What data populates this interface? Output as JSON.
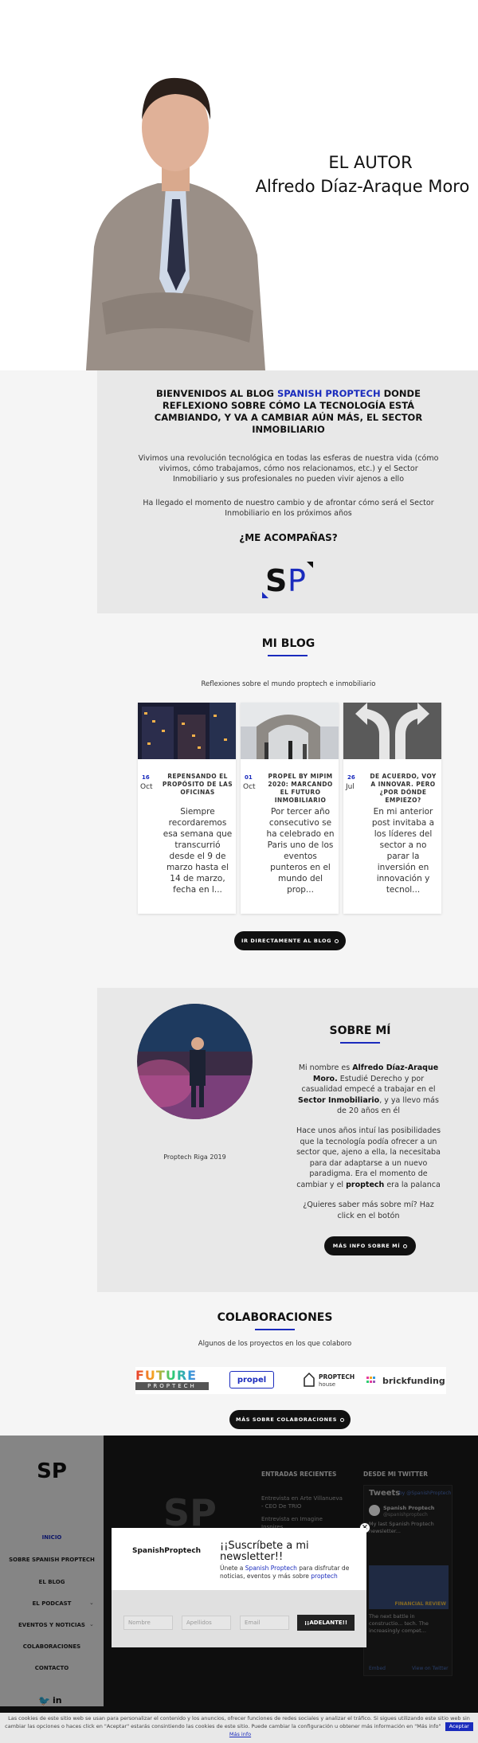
{
  "hero": {
    "line1": "EL AUTOR",
    "line2": "Alfredo Díaz-Araque Moro"
  },
  "welcome": {
    "heading_pre": "BIENVENIDOS AL BLOG",
    "heading_brand": "SPANISH PROPTECH",
    "heading_post": "DONDE REFLEXIONO SOBRE CÓMO LA TECNOLOGÍA ESTÁ CAMBIANDO, Y VA A CAMBIAR AÚN MÁS, EL SECTOR INMOBILIARIO",
    "para1": "Vivimos una revolución tecnológica en todas las esferas de nuestra vida (cómo vivimos, cómo trabajamos, cómo nos relacionamos, etc.) y el Sector Inmobiliario y sus profesionales no pueden vivir ajenos a ello",
    "para2": "Ha llegado el momento de nuestro cambio y de afrontar cómo será el Sector Inmobiliario en los próximos años",
    "question": "¿ME ACOMPAÑAS?",
    "logo_s": "S",
    "logo_p": "P"
  },
  "blog": {
    "title": "MI BLOG",
    "subtitle": "Reflexiones sobre el mundo proptech e inmobiliario",
    "posts": [
      {
        "day": "16",
        "month": "Oct",
        "title": "REPENSANDO EL PROPÓSITO DE LAS OFICINAS",
        "excerpt": "Siempre recordaremos esa semana que transcurrió desde el 9 de marzo hasta el 14 de marzo, fecha en l..."
      },
      {
        "day": "01",
        "month": "Oct",
        "title": "PROPEL BY MIPIM 2020: MARCANDO EL FUTURO INMOBILIARIO",
        "excerpt": "Por tercer año consecutivo se ha celebrado en Paris uno de los eventos punteros en el mundo del prop..."
      },
      {
        "day": "26",
        "month": "Jul",
        "title": "DE ACUERDO, VOY A INNOVAR. PERO ¿POR DÓNDE EMPIEZO?",
        "excerpt": "En mi anterior post invitaba a los líderes del sector a no parar la inversión en innovación y tecnol..."
      }
    ],
    "button": "IR DIRECTAMENTE AL BLOG"
  },
  "about": {
    "title": "SOBRE MÍ",
    "photo_caption": "Proptech Riga 2019",
    "p1_a": "Mi nombre es",
    "p1_name": "Alfredo Díaz-Araque Moro.",
    "p1_b": "Estudié Derecho y por casualidad empecé a trabajar en el",
    "p1_sector": "Sector Inmobiliario",
    "p1_c": ", y ya llevo más de 20 años en él",
    "p2_a": "Hace unos años intuí las posibilidades que la tecnología podía ofrecer a un sector que, ajeno a ella, la necesitaba para dar adaptarse a un nuevo paradigma. Era el momento de cambiar y el",
    "p2_bold": "proptech",
    "p2_b": "era la palanca",
    "p3": "¿Quieres saber más sobre mí? Haz click en el botón",
    "button": "MÁS INFO SOBRE MÍ"
  },
  "collab": {
    "title": "COLABORACIONES",
    "subtitle": "Algunos de los proyectos en los que colaboro",
    "logos": {
      "future_top": "FUTURE",
      "future_bottom": "PROPTECH",
      "propel": "propel",
      "proptech_house_a": "PROPTECH",
      "proptech_house_b": "house",
      "brickfunding": "brickfunding"
    },
    "button": "MÁS SOBRE COLABORACIONES"
  },
  "sidebar": {
    "logo": "SP",
    "menu": [
      "INICIO",
      "SOBRE SPANISH PROPTECH",
      "EL BLOG",
      "EL PODCAST",
      "EVENTOS Y NOTICIAS",
      "COLABORACIONES",
      "CONTACTO"
    ]
  },
  "footer": {
    "recent_title": "ENTRADAS RECIENTES",
    "recent": [
      "Entrevista en Arte Villanueva - CEO De TRIO",
      "Entrevista en Imagine Inspires..."
    ],
    "twitter_title": "DESDE MI TWITTER",
    "tweets_label": "Tweets",
    "tweets_by": "by @SpanishProptech",
    "tweet_user": "Spanish Proptech",
    "tweet_handle": "@spanishproptech",
    "tweet_text": "My last Spanish Proptech newsletter...",
    "tweet2_text": "The next battle in constructio... tech. The increasingly compet...",
    "tweet_image_label": "FINANCIAL REVIEW",
    "embed": "Embed",
    "view_twitter": "View on Twitter"
  },
  "popup": {
    "brand": "SpanishProptech",
    "title": "¡¡Suscríbete a mi newsletter!!",
    "text_a": "Únete a",
    "text_brand": "Spanish Proptech",
    "text_b": "para disfrutar de noticias, eventos y más sobre",
    "text_link": "proptech",
    "name_placeholder": "Nombre",
    "surname_placeholder": "Apellidos",
    "email_placeholder": "Email",
    "submit": "¡¡ADELANTE!!",
    "close": "×"
  },
  "cookies": {
    "text": "Las cookies de este sitio web se usan para personalizar el contenido y los anuncios, ofrecer funciones de redes sociales y analizar el tráfico. Si sigues utilizando este sitio web sin cambiar las opciones o haces click en \"Aceptar\" estarás consintiendo las cookies de este sitio. Puede cambiar la configuración u obtener más información en \"Más info\"",
    "accept": "Aceptar",
    "more": "Más info"
  },
  "colors": {
    "brand_blue": "#1a2bbd",
    "dark": "#111111",
    "grey_section": "#e8e8e8"
  }
}
